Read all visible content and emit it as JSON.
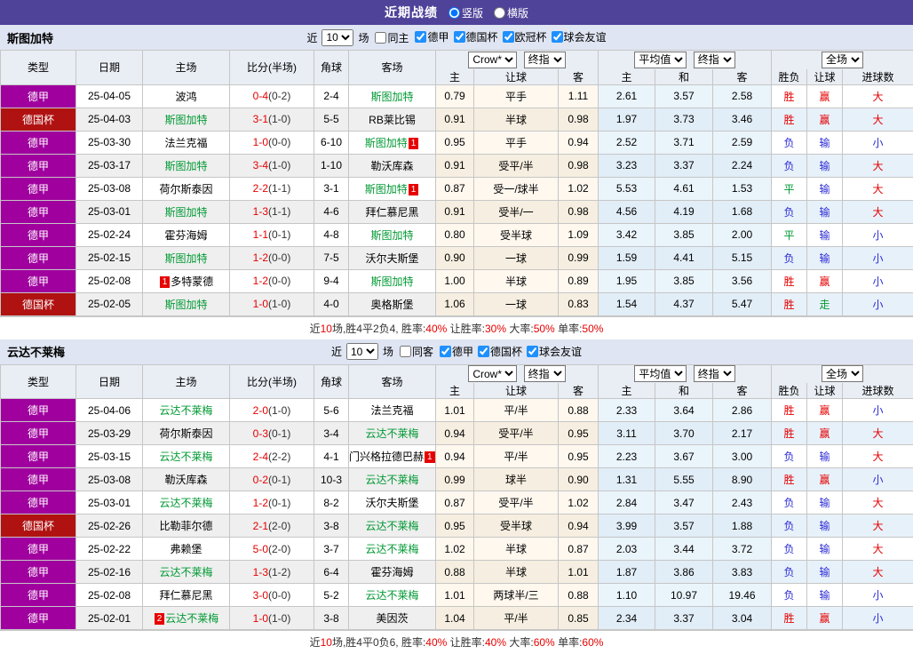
{
  "title_bar": {
    "title": "近期战绩",
    "radio_vertical": "竖版",
    "radio_horizontal": "横版"
  },
  "colors": {
    "titlebar_bg": "#4F4299",
    "band_bg": "#DFE5F2",
    "league_purple": "#A0009E",
    "cup_red": "#B01212",
    "team_green": "#009933",
    "score_red": "#E60000",
    "loss_blue": "#2B2BD5"
  },
  "table_header": {
    "type": "类型",
    "date": "日期",
    "home": "主场",
    "score": "比分(半场)",
    "corner": "角球",
    "away": "客场",
    "crow_select": "Crow*",
    "final_select": "终指",
    "avg_select": "平均值",
    "final_select2": "终指",
    "scope_select": "全场",
    "h_home": "主",
    "h_handicap": "让球",
    "h_away": "客",
    "a_home": "主",
    "a_draw": "和",
    "a_away": "客",
    "r_result": "胜负",
    "r_handicap": "让球",
    "r_goals": "进球数"
  },
  "sections": [
    {
      "team": "斯图加特",
      "filter": {
        "prefix": "近",
        "games": "10",
        "suffix": "场",
        "same_label": "同主",
        "same_checked": false,
        "leagues": [
          {
            "label": "德甲",
            "checked": true
          },
          {
            "label": "德国杯",
            "checked": true
          },
          {
            "label": "欧冠杯",
            "checked": true
          },
          {
            "label": "球会友谊",
            "checked": true
          }
        ]
      },
      "rows": [
        {
          "league": "德甲",
          "cup": false,
          "date": "25-04-05",
          "home": {
            "name": "波鸿",
            "team": false
          },
          "score": "0-4",
          "half": "(0-2)",
          "corner": "2-4",
          "away": {
            "name": "斯图加特",
            "team": true
          },
          "odds": [
            "0.79",
            "平手",
            "1.11"
          ],
          "avg": [
            "2.61",
            "3.57",
            "2.58"
          ],
          "res": [
            {
              "t": "胜",
              "c": "r"
            },
            {
              "t": "赢",
              "c": "r"
            },
            {
              "t": "大",
              "c": "r"
            }
          ]
        },
        {
          "league": "德国杯",
          "cup": true,
          "date": "25-04-03",
          "home": {
            "name": "斯图加特",
            "team": true
          },
          "score": "3-1",
          "half": "(1-0)",
          "corner": "5-5",
          "away": {
            "name": "RB莱比锡",
            "team": false
          },
          "odds": [
            "0.91",
            "半球",
            "0.98"
          ],
          "avg": [
            "1.97",
            "3.73",
            "3.46"
          ],
          "res": [
            {
              "t": "胜",
              "c": "r"
            },
            {
              "t": "赢",
              "c": "r"
            },
            {
              "t": "大",
              "c": "r"
            }
          ]
        },
        {
          "league": "德甲",
          "cup": false,
          "date": "25-03-30",
          "home": {
            "name": "法兰克福",
            "team": false
          },
          "score": "1-0",
          "half": "(0-0)",
          "corner": "6-10",
          "away": {
            "name": "斯图加特",
            "team": true,
            "badge": "1",
            "badge_pos": "post"
          },
          "odds": [
            "0.95",
            "平手",
            "0.94"
          ],
          "avg": [
            "2.52",
            "3.71",
            "2.59"
          ],
          "res": [
            {
              "t": "负",
              "c": "b"
            },
            {
              "t": "输",
              "c": "b"
            },
            {
              "t": "小",
              "c": "b"
            }
          ]
        },
        {
          "league": "德甲",
          "cup": false,
          "date": "25-03-17",
          "home": {
            "name": "斯图加特",
            "team": true
          },
          "score": "3-4",
          "half": "(1-0)",
          "corner": "1-10",
          "away": {
            "name": "勒沃库森",
            "team": false
          },
          "odds": [
            "0.91",
            "受平/半",
            "0.98"
          ],
          "avg": [
            "3.23",
            "3.37",
            "2.24"
          ],
          "res": [
            {
              "t": "负",
              "c": "b"
            },
            {
              "t": "输",
              "c": "b"
            },
            {
              "t": "大",
              "c": "r"
            }
          ]
        },
        {
          "league": "德甲",
          "cup": false,
          "date": "25-03-08",
          "home": {
            "name": "荷尔斯泰因",
            "team": false
          },
          "score": "2-2",
          "half": "(1-1)",
          "corner": "3-1",
          "away": {
            "name": "斯图加特",
            "team": true,
            "badge": "1",
            "badge_pos": "post"
          },
          "odds": [
            "0.87",
            "受一/球半",
            "1.02"
          ],
          "avg": [
            "5.53",
            "4.61",
            "1.53"
          ],
          "res": [
            {
              "t": "平",
              "c": "g"
            },
            {
              "t": "输",
              "c": "b"
            },
            {
              "t": "大",
              "c": "r"
            }
          ]
        },
        {
          "league": "德甲",
          "cup": false,
          "date": "25-03-01",
          "home": {
            "name": "斯图加特",
            "team": true
          },
          "score": "1-3",
          "half": "(1-1)",
          "corner": "4-6",
          "away": {
            "name": "拜仁慕尼黑",
            "team": false
          },
          "odds": [
            "0.91",
            "受半/一",
            "0.98"
          ],
          "avg": [
            "4.56",
            "4.19",
            "1.68"
          ],
          "res": [
            {
              "t": "负",
              "c": "b"
            },
            {
              "t": "输",
              "c": "b"
            },
            {
              "t": "大",
              "c": "r"
            }
          ]
        },
        {
          "league": "德甲",
          "cup": false,
          "date": "25-02-24",
          "home": {
            "name": "霍芬海姆",
            "team": false
          },
          "score": "1-1",
          "half": "(0-1)",
          "corner": "4-8",
          "away": {
            "name": "斯图加特",
            "team": true
          },
          "odds": [
            "0.80",
            "受半球",
            "1.09"
          ],
          "avg": [
            "3.42",
            "3.85",
            "2.00"
          ],
          "res": [
            {
              "t": "平",
              "c": "g"
            },
            {
              "t": "输",
              "c": "b"
            },
            {
              "t": "小",
              "c": "b"
            }
          ]
        },
        {
          "league": "德甲",
          "cup": false,
          "date": "25-02-15",
          "home": {
            "name": "斯图加特",
            "team": true
          },
          "score": "1-2",
          "half": "(0-0)",
          "corner": "7-5",
          "away": {
            "name": "沃尔夫斯堡",
            "team": false
          },
          "odds": [
            "0.90",
            "一球",
            "0.99"
          ],
          "avg": [
            "1.59",
            "4.41",
            "5.15"
          ],
          "res": [
            {
              "t": "负",
              "c": "b"
            },
            {
              "t": "输",
              "c": "b"
            },
            {
              "t": "小",
              "c": "b"
            }
          ]
        },
        {
          "league": "德甲",
          "cup": false,
          "date": "25-02-08",
          "home": {
            "name": "多特蒙德",
            "team": false,
            "badge": "1",
            "badge_pos": "pre"
          },
          "score": "1-2",
          "half": "(0-0)",
          "corner": "9-4",
          "away": {
            "name": "斯图加特",
            "team": true
          },
          "odds": [
            "1.00",
            "半球",
            "0.89"
          ],
          "avg": [
            "1.95",
            "3.85",
            "3.56"
          ],
          "res": [
            {
              "t": "胜",
              "c": "r"
            },
            {
              "t": "赢",
              "c": "r"
            },
            {
              "t": "小",
              "c": "b"
            }
          ]
        },
        {
          "league": "德国杯",
          "cup": true,
          "date": "25-02-05",
          "home": {
            "name": "斯图加特",
            "team": true
          },
          "score": "1-0",
          "half": "(1-0)",
          "corner": "4-0",
          "away": {
            "name": "奥格斯堡",
            "team": false
          },
          "odds": [
            "1.06",
            "一球",
            "0.83"
          ],
          "avg": [
            "1.54",
            "4.37",
            "5.47"
          ],
          "res": [
            {
              "t": "胜",
              "c": "r"
            },
            {
              "t": "走",
              "c": "g"
            },
            {
              "t": "小",
              "c": "b"
            }
          ]
        }
      ],
      "summary": [
        {
          "t": "近",
          "c": "k"
        },
        {
          "t": "10",
          "c": "r"
        },
        {
          "t": "场,胜4平2负4, 胜率:",
          "c": "k"
        },
        {
          "t": "40%",
          "c": "r"
        },
        {
          "t": " 让胜率:",
          "c": "k"
        },
        {
          "t": "30%",
          "c": "r"
        },
        {
          "t": " 大率:",
          "c": "k"
        },
        {
          "t": "50%",
          "c": "r"
        },
        {
          "t": " 单率:",
          "c": "k"
        },
        {
          "t": "50%",
          "c": "r"
        }
      ]
    },
    {
      "team": "云达不莱梅",
      "filter": {
        "prefix": "近",
        "games": "10",
        "suffix": "场",
        "same_label": "同客",
        "same_checked": false,
        "leagues": [
          {
            "label": "德甲",
            "checked": true
          },
          {
            "label": "德国杯",
            "checked": true
          },
          {
            "label": "球会友谊",
            "checked": true
          }
        ]
      },
      "rows": [
        {
          "league": "德甲",
          "cup": false,
          "date": "25-04-06",
          "home": {
            "name": "云达不莱梅",
            "team": true
          },
          "score": "2-0",
          "half": "(1-0)",
          "corner": "5-6",
          "away": {
            "name": "法兰克福",
            "team": false
          },
          "odds": [
            "1.01",
            "平/半",
            "0.88"
          ],
          "avg": [
            "2.33",
            "3.64",
            "2.86"
          ],
          "res": [
            {
              "t": "胜",
              "c": "r"
            },
            {
              "t": "赢",
              "c": "r"
            },
            {
              "t": "小",
              "c": "b"
            }
          ]
        },
        {
          "league": "德甲",
          "cup": false,
          "date": "25-03-29",
          "home": {
            "name": "荷尔斯泰因",
            "team": false
          },
          "score": "0-3",
          "half": "(0-1)",
          "corner": "3-4",
          "away": {
            "name": "云达不莱梅",
            "team": true
          },
          "odds": [
            "0.94",
            "受平/半",
            "0.95"
          ],
          "avg": [
            "3.11",
            "3.70",
            "2.17"
          ],
          "res": [
            {
              "t": "胜",
              "c": "r"
            },
            {
              "t": "赢",
              "c": "r"
            },
            {
              "t": "大",
              "c": "r"
            }
          ]
        },
        {
          "league": "德甲",
          "cup": false,
          "date": "25-03-15",
          "home": {
            "name": "云达不莱梅",
            "team": true
          },
          "score": "2-4",
          "half": "(2-2)",
          "corner": "4-1",
          "away": {
            "name": "门兴格拉德巴赫",
            "team": false,
            "badge": "1",
            "badge_pos": "post"
          },
          "odds": [
            "0.94",
            "平/半",
            "0.95"
          ],
          "avg": [
            "2.23",
            "3.67",
            "3.00"
          ],
          "res": [
            {
              "t": "负",
              "c": "b"
            },
            {
              "t": "输",
              "c": "b"
            },
            {
              "t": "大",
              "c": "r"
            }
          ]
        },
        {
          "league": "德甲",
          "cup": false,
          "date": "25-03-08",
          "home": {
            "name": "勒沃库森",
            "team": false
          },
          "score": "0-2",
          "half": "(0-1)",
          "corner": "10-3",
          "away": {
            "name": "云达不莱梅",
            "team": true
          },
          "odds": [
            "0.99",
            "球半",
            "0.90"
          ],
          "avg": [
            "1.31",
            "5.55",
            "8.90"
          ],
          "res": [
            {
              "t": "胜",
              "c": "r"
            },
            {
              "t": "赢",
              "c": "r"
            },
            {
              "t": "小",
              "c": "b"
            }
          ]
        },
        {
          "league": "德甲",
          "cup": false,
          "date": "25-03-01",
          "home": {
            "name": "云达不莱梅",
            "team": true
          },
          "score": "1-2",
          "half": "(0-1)",
          "corner": "8-2",
          "away": {
            "name": "沃尔夫斯堡",
            "team": false
          },
          "odds": [
            "0.87",
            "受平/半",
            "1.02"
          ],
          "avg": [
            "2.84",
            "3.47",
            "2.43"
          ],
          "res": [
            {
              "t": "负",
              "c": "b"
            },
            {
              "t": "输",
              "c": "b"
            },
            {
              "t": "大",
              "c": "r"
            }
          ]
        },
        {
          "league": "德国杯",
          "cup": true,
          "date": "25-02-26",
          "home": {
            "name": "比勒菲尔德",
            "team": false
          },
          "score": "2-1",
          "half": "(2-0)",
          "corner": "3-8",
          "away": {
            "name": "云达不莱梅",
            "team": true
          },
          "odds": [
            "0.95",
            "受半球",
            "0.94"
          ],
          "avg": [
            "3.99",
            "3.57",
            "1.88"
          ],
          "res": [
            {
              "t": "负",
              "c": "b"
            },
            {
              "t": "输",
              "c": "b"
            },
            {
              "t": "大",
              "c": "r"
            }
          ]
        },
        {
          "league": "德甲",
          "cup": false,
          "date": "25-02-22",
          "home": {
            "name": "弗赖堡",
            "team": false
          },
          "score": "5-0",
          "half": "(2-0)",
          "corner": "3-7",
          "away": {
            "name": "云达不莱梅",
            "team": true
          },
          "odds": [
            "1.02",
            "半球",
            "0.87"
          ],
          "avg": [
            "2.03",
            "3.44",
            "3.72"
          ],
          "res": [
            {
              "t": "负",
              "c": "b"
            },
            {
              "t": "输",
              "c": "b"
            },
            {
              "t": "大",
              "c": "r"
            }
          ]
        },
        {
          "league": "德甲",
          "cup": false,
          "date": "25-02-16",
          "home": {
            "name": "云达不莱梅",
            "team": true
          },
          "score": "1-3",
          "half": "(1-2)",
          "corner": "6-4",
          "away": {
            "name": "霍芬海姆",
            "team": false
          },
          "odds": [
            "0.88",
            "半球",
            "1.01"
          ],
          "avg": [
            "1.87",
            "3.86",
            "3.83"
          ],
          "res": [
            {
              "t": "负",
              "c": "b"
            },
            {
              "t": "输",
              "c": "b"
            },
            {
              "t": "大",
              "c": "r"
            }
          ]
        },
        {
          "league": "德甲",
          "cup": false,
          "date": "25-02-08",
          "home": {
            "name": "拜仁慕尼黑",
            "team": false
          },
          "score": "3-0",
          "half": "(0-0)",
          "corner": "5-2",
          "away": {
            "name": "云达不莱梅",
            "team": true
          },
          "odds": [
            "1.01",
            "两球半/三",
            "0.88"
          ],
          "avg": [
            "1.10",
            "10.97",
            "19.46"
          ],
          "res": [
            {
              "t": "负",
              "c": "b"
            },
            {
              "t": "输",
              "c": "b"
            },
            {
              "t": "小",
              "c": "b"
            }
          ]
        },
        {
          "league": "德甲",
          "cup": false,
          "date": "25-02-01",
          "home": {
            "name": "云达不莱梅",
            "team": true,
            "badge": "2",
            "badge_pos": "pre"
          },
          "score": "1-0",
          "half": "(1-0)",
          "corner": "3-8",
          "away": {
            "name": "美因茨",
            "team": false
          },
          "odds": [
            "1.04",
            "平/半",
            "0.85"
          ],
          "avg": [
            "2.34",
            "3.37",
            "3.04"
          ],
          "res": [
            {
              "t": "胜",
              "c": "r"
            },
            {
              "t": "赢",
              "c": "r"
            },
            {
              "t": "小",
              "c": "b"
            }
          ]
        }
      ],
      "summary": [
        {
          "t": "近",
          "c": "k"
        },
        {
          "t": "10",
          "c": "r"
        },
        {
          "t": "场,胜4平0负6, 胜率:",
          "c": "k"
        },
        {
          "t": "40%",
          "c": "r"
        },
        {
          "t": " 让胜率:",
          "c": "k"
        },
        {
          "t": "40%",
          "c": "r"
        },
        {
          "t": " 大率:",
          "c": "k"
        },
        {
          "t": "60%",
          "c": "r"
        },
        {
          "t": " 单率:",
          "c": "k"
        },
        {
          "t": "60%",
          "c": "r"
        }
      ]
    }
  ]
}
